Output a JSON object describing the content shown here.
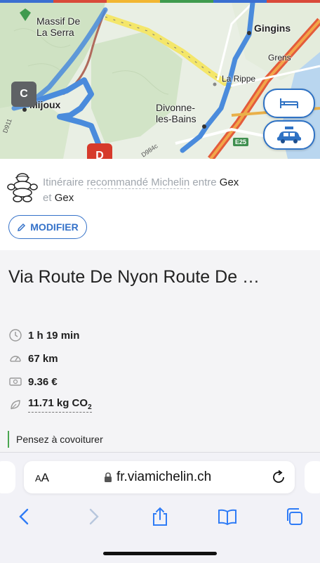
{
  "top_colors": [
    "#3b6fd1",
    "#d94a3a",
    "#f2b632",
    "#3f9b4e",
    "#3b6fd1",
    "#d94a3a"
  ],
  "map": {
    "labels": {
      "massif": "Massif De\nLa Serra",
      "gingins": "Gingins",
      "grens": "Grens",
      "la_rippe": "La Rippe",
      "mijoux": "Mijoux",
      "divonne": "Divonne-\nles-Bains",
      "road_e25": "E25",
      "road_d984c": "D984c",
      "road_d911": "D911"
    },
    "marker_c": "C",
    "marker_d": "D",
    "route_color": "#4a8bdc",
    "marker_c_color": "#5f6265",
    "marker_d_color": "#d63a2b"
  },
  "itinerary": {
    "text_prefix": "Itinéraire ",
    "text_recommande": "recommandé Michelin",
    "text_entre": " entre ",
    "from": "Gex",
    "et": "et ",
    "to": "Gex",
    "modify_label": "MODIFIER"
  },
  "route": {
    "title": "Via Route De Nyon Route De …",
    "duration": "1 h 19 min",
    "distance": "67 km",
    "cost": "9.36 €",
    "co2_value": "11.71 kg CO",
    "co2_sub": "2",
    "carpool": "Pensez à covoiturer"
  },
  "browser": {
    "aa_label_small": "A",
    "aa_label_big": "A",
    "url": "fr.viamichelin.ch"
  },
  "colors": {
    "accent": "#3572c9",
    "ios_blue": "#2f7cf6",
    "green_bar": "#4aa650"
  }
}
